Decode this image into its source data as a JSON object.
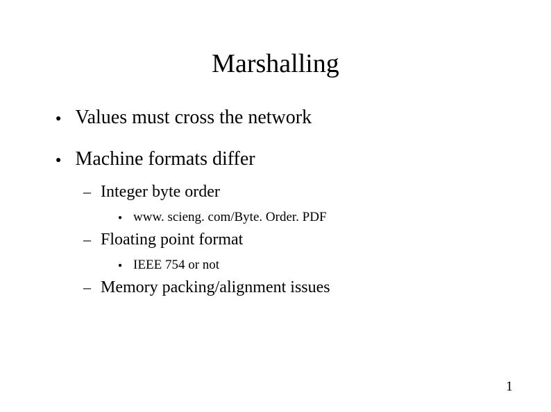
{
  "slide": {
    "title": "Marshalling",
    "bullets": [
      "Values must cross the network",
      "Machine formats differ"
    ],
    "sub": {
      "0": "Integer byte order",
      "1": "Floating point format",
      "2": "Memory packing/alignment issues"
    },
    "subsub": {
      "0": "www. scieng. com/Byte. Order. PDF",
      "1": "IEEE 754 or not"
    },
    "pageNumber": "1"
  }
}
